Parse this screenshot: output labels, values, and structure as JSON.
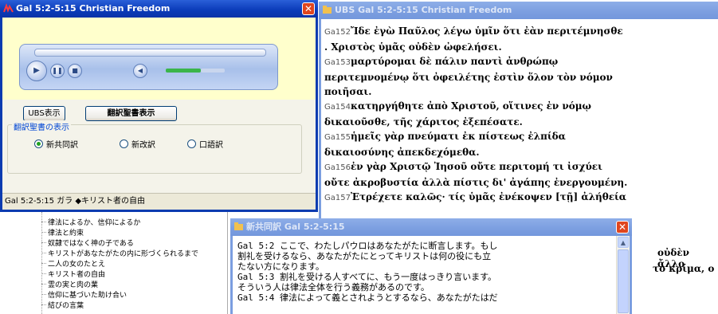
{
  "colors": {
    "title_active": "#0a3ab8",
    "title_inactive": "#7b9ee0",
    "close": "#e0461e",
    "player_bg": "#ffffcc"
  },
  "window_main": {
    "title": "Gal 5:2-5:15 Christian Freedom",
    "buttons": {
      "ubs": "UBS表示",
      "translation": "翻訳聖書表示"
    },
    "group_label": "翻訳聖書の表示",
    "radios": [
      {
        "label": "新共同訳",
        "selected": true
      },
      {
        "label": "新改訳",
        "selected": false
      },
      {
        "label": "口語訳",
        "selected": false
      }
    ],
    "status": "Gal 5:2-5:15 ガラ  ◆キリスト者の自由"
  },
  "window_ubs": {
    "title": "UBS Gal 5:2-5:15 Christian Freedom",
    "lines": [
      {
        "ref": "Ga152",
        "text": "Ἴδε ἐγὼ Παῦλος λέγω ὑμῖν ὅτι ἐὰν περιτέμνησθε"
      },
      {
        "ref": "",
        "text": ". Χριστὸς ὑμᾶς οὐδὲν ὠφελήσει."
      },
      {
        "ref": "Ga153",
        "text": "μαρτύρομαι δὲ πάλιν παντὶ ἀνθρώπῳ"
      },
      {
        "ref": "",
        "text": "περιτεμνομένῳ ὅτι ὀφειλέτης ἐστὶν ὅλον τὸν νόμον"
      },
      {
        "ref": "",
        "text": "ποιῆσαι."
      },
      {
        "ref": "Ga154",
        "text": "κατηργήθητε ἀπὸ Χριστοῦ, οἵτινες ἐν νόμῳ"
      },
      {
        "ref": "",
        "text": "δικαιοῦσθε, τῆς χάριτος ἐξεπέσατε."
      },
      {
        "ref": "Ga155",
        "text": "ἡμεῖς γὰρ πνεύματι ἐκ πίστεως ἐλπίδα"
      },
      {
        "ref": "",
        "text": "δικαιοσύνης ἀπεκδεχόμεθα."
      },
      {
        "ref": "Ga156",
        "text": "ἐν γὰρ Χριστῷ Ἰησοῦ οὔτε περιτομή τι ἰσχύει"
      },
      {
        "ref": "",
        "text": "οὔτε ἀκροβυστία ἀλλὰ πίστις δι' ἀγάπης ἐνεργουμένη."
      },
      {
        "ref": "Ga157",
        "text": "Ἐτρέχετε καλῶς· τίς ὑμᾶς ἐνέκοψεν [τῇ] ἀλήθεία"
      }
    ],
    "tail_1": "οὐδὲν ἄλλο",
    "tail_2": "τὸ κρίμα, ο"
  },
  "tree": {
    "items": [
      "律法によるか、信仰によるか",
      "律法と約束",
      "奴隷ではなく神の子である",
      "キリストがあなたがたの内に形づくられるまで",
      "二人の女のたとえ",
      "キリスト者の自由",
      "霊の実と肉の業",
      "信仰に基づいた助け合い",
      "結びの言葉"
    ]
  },
  "window_jp": {
    "title": "新共同訳 Gal 5:2-5:15",
    "lines": [
      "Gal 5:2 ここで、わたしパウロはあなたがたに断言します。もし",
      "割礼を受けるなら、あなたがたにとってキリストは何の役にも立",
      "たない方になります。",
      "Gal 5:3 割礼を受ける人すべてに、もう一度はっきり言います。",
      "そういう人は律法全体を行う義務があるのです。",
      "Gal 5:4 律法によって義とされようとするなら、あなたがたはだ"
    ]
  }
}
